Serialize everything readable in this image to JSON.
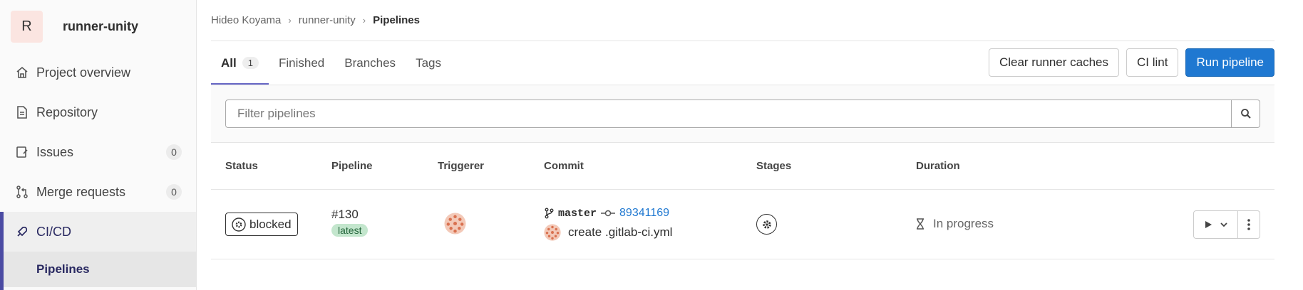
{
  "sidebar": {
    "project_initial": "R",
    "project_name": "runner-unity",
    "items": [
      {
        "label": "Project overview",
        "icon": "home-icon"
      },
      {
        "label": "Repository",
        "icon": "document-icon"
      },
      {
        "label": "Issues",
        "icon": "issues-icon",
        "count": "0"
      },
      {
        "label": "Merge requests",
        "icon": "merge-request-icon",
        "count": "0"
      },
      {
        "label": "CI/CD",
        "icon": "rocket-icon"
      }
    ],
    "sub_item": "Pipelines"
  },
  "breadcrumb": [
    "Hideo Koyama",
    "runner-unity",
    "Pipelines"
  ],
  "tabs": [
    {
      "label": "All",
      "count": "1"
    },
    {
      "label": "Finished"
    },
    {
      "label": "Branches"
    },
    {
      "label": "Tags"
    }
  ],
  "actions": {
    "clear_caches": "Clear runner caches",
    "ci_lint": "CI lint",
    "run_pipeline": "Run pipeline"
  },
  "filter": {
    "placeholder": "Filter pipelines"
  },
  "table": {
    "headers": [
      "Status",
      "Pipeline",
      "Triggerer",
      "Commit",
      "Stages",
      "Duration"
    ],
    "rows": [
      {
        "status": "blocked",
        "pipeline_id": "#130",
        "tag": "latest",
        "branch": "master",
        "sha": "89341169",
        "commit_message": "create .gitlab-ci.yml",
        "duration": "In progress"
      }
    ]
  },
  "colors": {
    "accent": "#1f78d1",
    "sidebar_active": "#4b4ba3",
    "latest_bg": "#c3e6cd"
  }
}
